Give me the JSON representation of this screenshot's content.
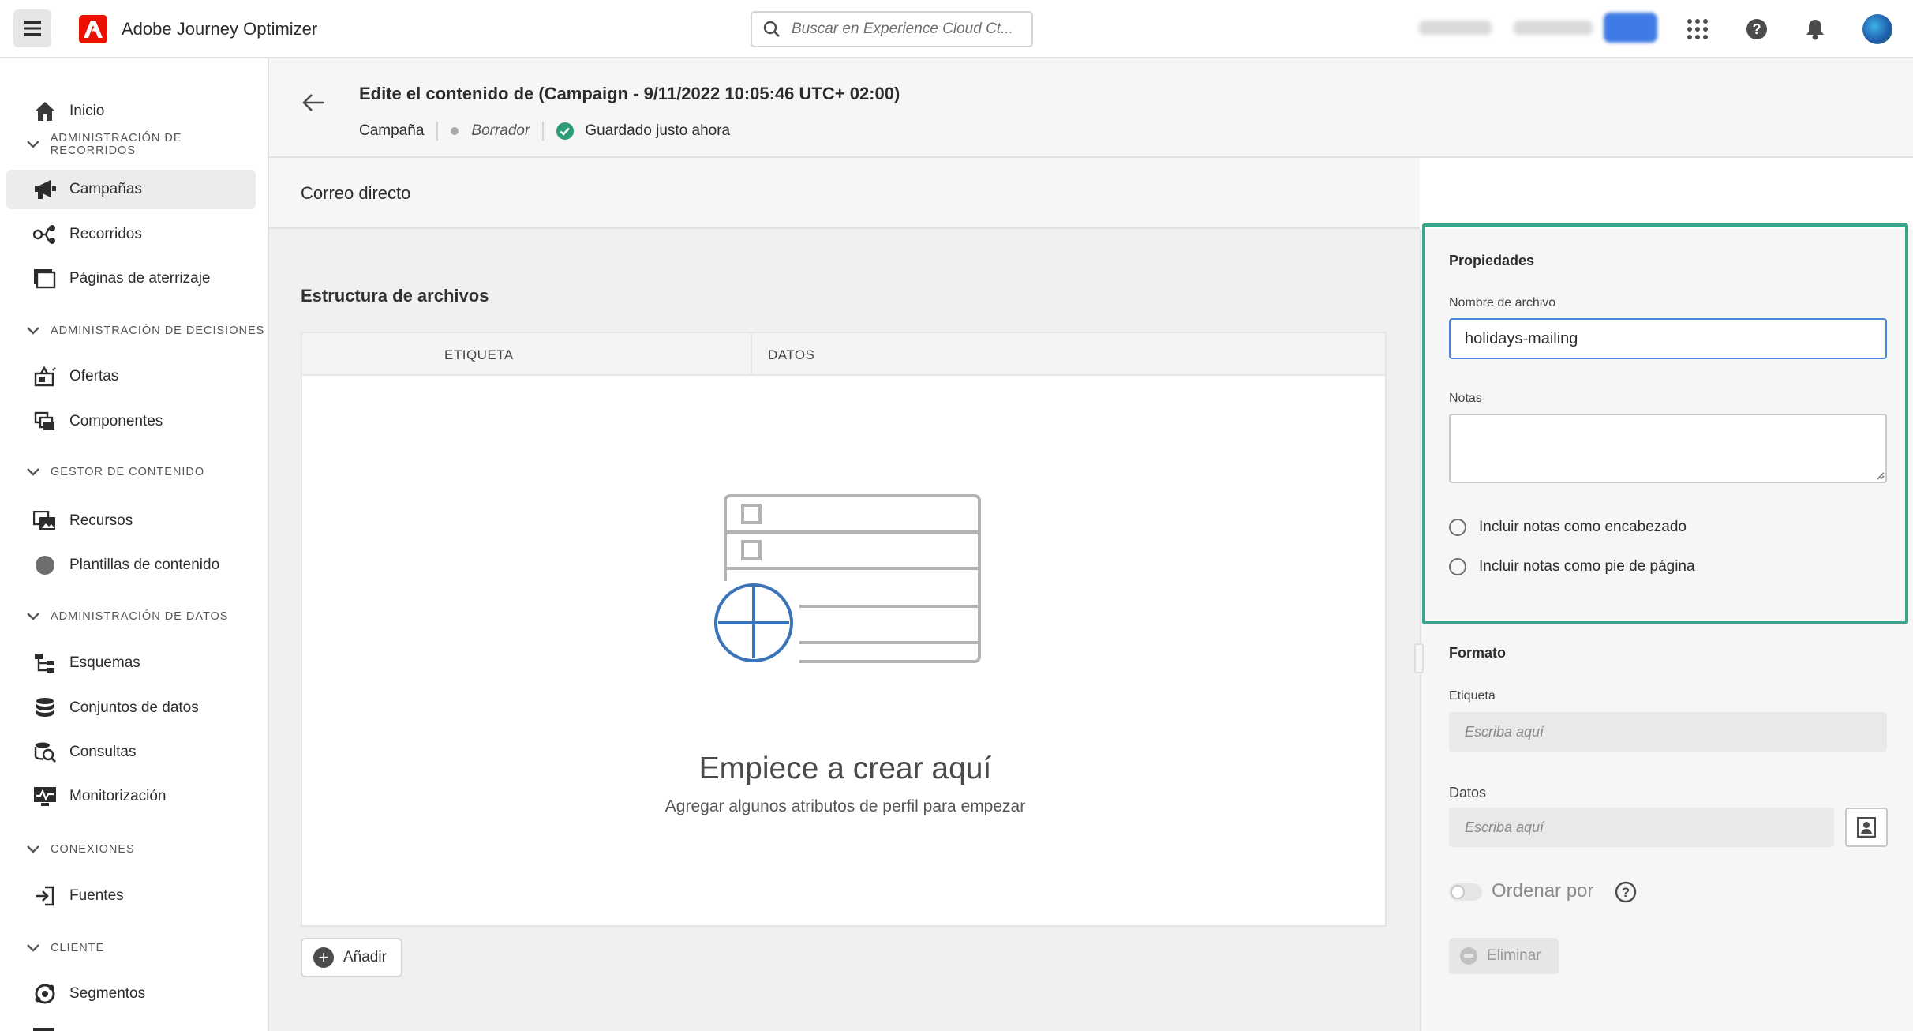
{
  "app": {
    "name": "Adobe Journey Optimizer"
  },
  "search": {
    "placeholder": "Buscar en Experience Cloud Ct..."
  },
  "sidebar": {
    "home": "Inicio",
    "sections": [
      {
        "title": "Administración de recorridos",
        "items": [
          "Campañas",
          "Recorridos",
          "Páginas de aterrizaje"
        ]
      },
      {
        "title": "Administración de decisiones",
        "items": [
          "Ofertas",
          "Componentes"
        ]
      },
      {
        "title": "Gestor de contenido",
        "items": [
          "Recursos",
          "Plantillas de contenido"
        ]
      },
      {
        "title": "Administración de datos",
        "items": [
          "Esquemas",
          "Conjuntos de datos",
          "Consultas",
          "Monitorización"
        ]
      },
      {
        "title": "Conexiones",
        "items": [
          "Fuentes"
        ]
      },
      {
        "title": "Cliente",
        "items": [
          "Segmentos"
        ]
      }
    ],
    "active_item": "Campañas"
  },
  "titlebar": {
    "title": "Edite el contenido de (Campaign - 9/11/2022 10:05:46 UTC+ 02:00)",
    "crumb_type": "Campaña",
    "crumb_status": "Borrador",
    "crumb_saved": "Guardado justo ahora"
  },
  "subtitle": "Correo directo",
  "main": {
    "section_title": "Estructura de archivos",
    "columns": [
      "ETIQUETA",
      "DATOS"
    ],
    "empty_title": "Empiece a crear aquí",
    "empty_sub": "Agregar algunos atributos de perfil para empezar",
    "add_label": "Añadir"
  },
  "properties": {
    "heading": "Propiedades",
    "filename_label": "Nombre de archivo",
    "filename_value": "holidays-mailing",
    "notes_label": "Notas",
    "notes_value": "",
    "radio_header": "Incluir notas como encabezado",
    "radio_footer": "Incluir notas como pie de página"
  },
  "format": {
    "heading": "Formato",
    "label_label": "Etiqueta",
    "label_placeholder": "Escriba aquí",
    "data_label": "Datos",
    "data_placeholder": "Escriba aquí",
    "sort_label": "Ordenar por",
    "sort_enabled": false,
    "delete_label": "Eliminar"
  },
  "colors": {
    "accent": "#3aa58a",
    "brand": "#eb1000",
    "focus": "#4a86d8",
    "saved": "#2d9d78"
  }
}
